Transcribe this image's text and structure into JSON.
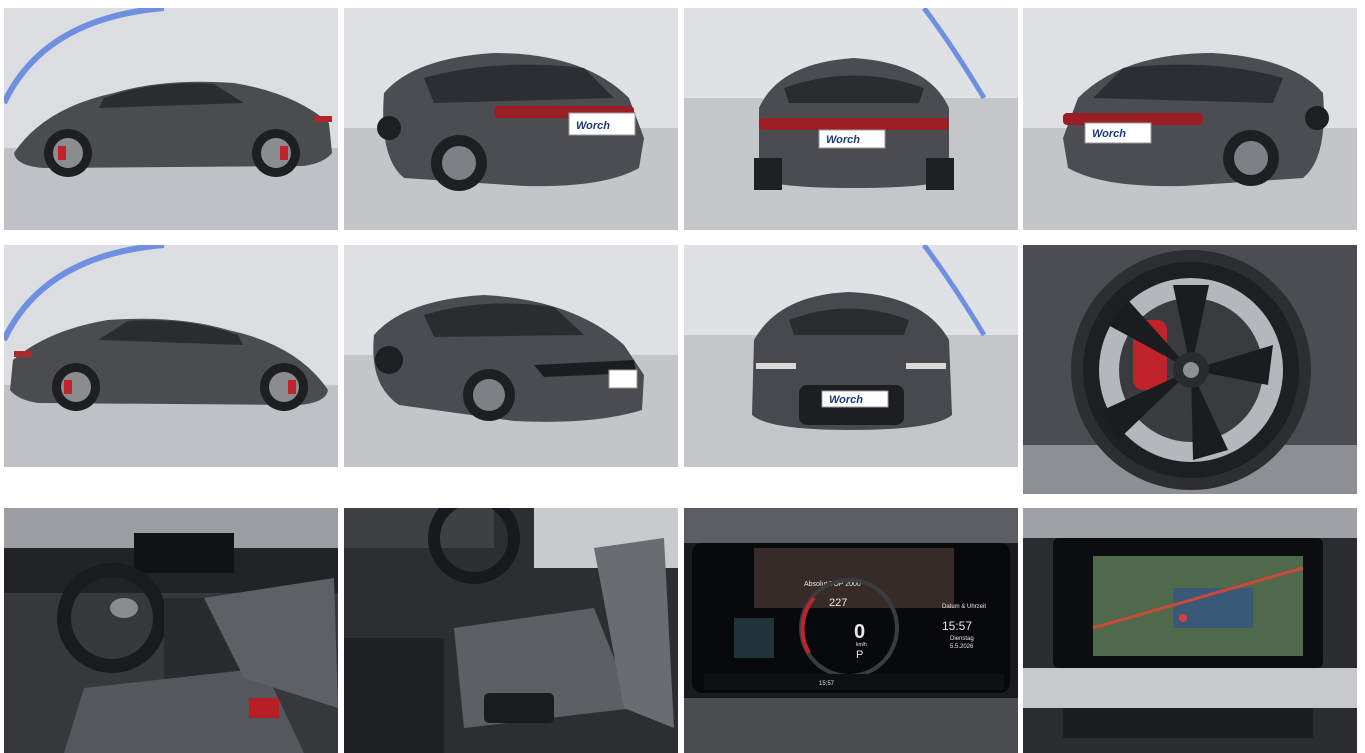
{
  "gallery": {
    "plate_text": "Worch",
    "cluster": {
      "speed_unit": "km/h",
      "range": "227",
      "speed": "0",
      "gear": "P",
      "datetime_title": "Datum & Uhrzeit",
      "time": "15:57",
      "weekday": "Dienstag",
      "date": "5.5.2026",
      "bottom_time": "15:57",
      "top_message": "Absolut TOP 2000"
    }
  }
}
